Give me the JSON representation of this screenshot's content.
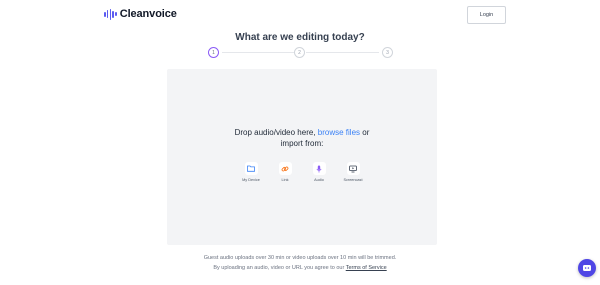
{
  "header": {
    "brand": "Cleanvoice",
    "login_label": "Login"
  },
  "main": {
    "title": "What are we editing today?",
    "steps": [
      "1",
      "2",
      "3"
    ],
    "drop_text_prefix": "Drop audio/video here,",
    "browse_label": "browse files",
    "drop_text_suffix": "or",
    "import_from": "import from:",
    "sources": [
      {
        "label": "My Device",
        "icon": "folder-icon"
      },
      {
        "label": "Link",
        "icon": "link-icon"
      },
      {
        "label": "Audio",
        "icon": "microphone-icon"
      },
      {
        "label": "Screencast",
        "icon": "screen-icon"
      }
    ]
  },
  "footer": {
    "notice_line1": "Guest audio uploads over 30 min or video uploads over 10 min will be trimmed.",
    "notice_line2_prefix": "By uploading an audio, video or URL you agree to our",
    "tos_label": "Terms of Service"
  },
  "colors": {
    "accent": "#4f46e5",
    "link": "#3b82f6",
    "dropzone_bg": "#f3f4f6"
  }
}
